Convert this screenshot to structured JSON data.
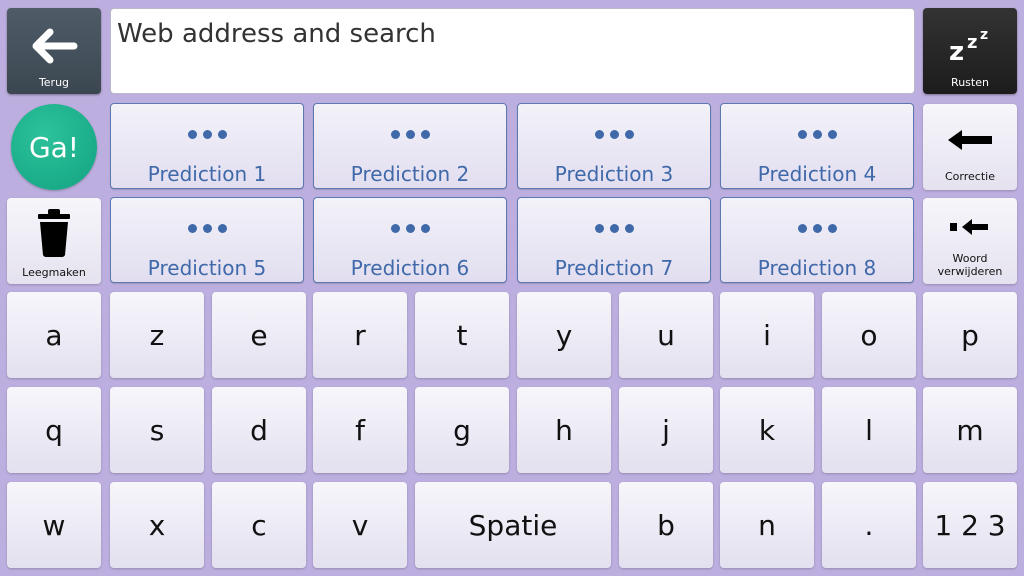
{
  "top_bar": {
    "back_label": "Terug",
    "address_placeholder": "Web address and search",
    "rest_label": "Rusten"
  },
  "go_label": "Ga!",
  "clear_label": "Leegmaken",
  "correction_label": "Correctie",
  "delete_word_label": "Woord verwijderen",
  "predictions": [
    "Prediction 1",
    "Prediction 2",
    "Prediction 3",
    "Prediction 4",
    "Prediction 5",
    "Prediction 6",
    "Prediction 7",
    "Prediction 8"
  ],
  "keys": {
    "row1": [
      "a",
      "z",
      "e",
      "r",
      "t",
      "y",
      "u",
      "i",
      "o",
      "p"
    ],
    "row2": [
      "q",
      "s",
      "d",
      "f",
      "g",
      "h",
      "j",
      "k",
      "l",
      "m"
    ],
    "row3": [
      "w",
      "x",
      "c",
      "v",
      "Spatie",
      "b",
      "n",
      ".",
      "1 2 3"
    ]
  },
  "colors": {
    "background": "#bcaede",
    "prediction_text": "#3f69a9",
    "go_button": "#19a889",
    "back_button": "#46525c",
    "rest_button": "#262626"
  }
}
